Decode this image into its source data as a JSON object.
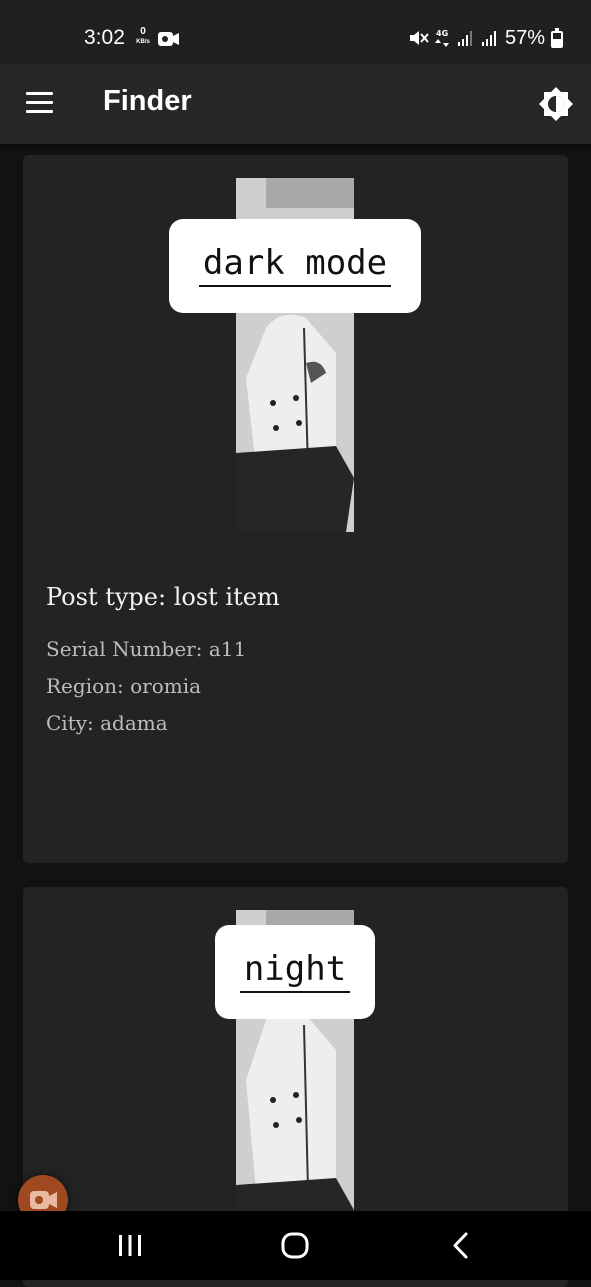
{
  "status_bar": {
    "time": "3:02",
    "data_rate_value": "0",
    "data_rate_unit": "KB/s",
    "battery_percent": "57%",
    "icons": [
      "video-camera-icon",
      "mute-icon",
      "4g-data-icon",
      "signal-icon",
      "signal-icon",
      "battery-icon"
    ]
  },
  "app_bar": {
    "title": "Finder",
    "menu_icon": "hamburger-menu-icon",
    "action_icon": "brightness-toggle-icon"
  },
  "posts": [
    {
      "image_caption": "dark mode",
      "post_type": "Post type: lost item",
      "serial": "Serial Number: a11",
      "region": "Region: oromia",
      "city": "City: adama"
    },
    {
      "image_caption": "night"
    }
  ],
  "floating_button": {
    "icon": "video-camera-icon",
    "color": "#a0481f"
  },
  "nav_bar": {
    "icons": [
      "recent-apps-icon",
      "home-icon",
      "back-icon"
    ]
  },
  "colors": {
    "background": "#121212",
    "app_bar": "#272727",
    "card": "#232323"
  }
}
